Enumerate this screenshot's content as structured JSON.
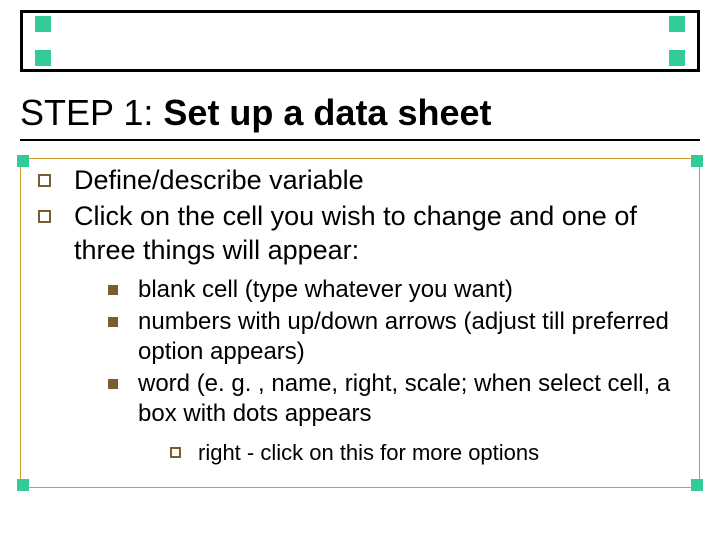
{
  "title": {
    "prefix": "STEP 1: ",
    "main": "Set up a data sheet"
  },
  "bullets": {
    "level1": [
      "Define/describe variable",
      "Click on the cell you wish to change and one of three things will appear:"
    ],
    "level2": [
      "blank cell (type whatever you want)",
      "numbers with up/down arrows (adjust till preferred option appears)",
      "word (e. g. , name, right, scale; when select cell,  a box with dots appears"
    ],
    "level3": [
      "right - click on this for more options"
    ]
  }
}
